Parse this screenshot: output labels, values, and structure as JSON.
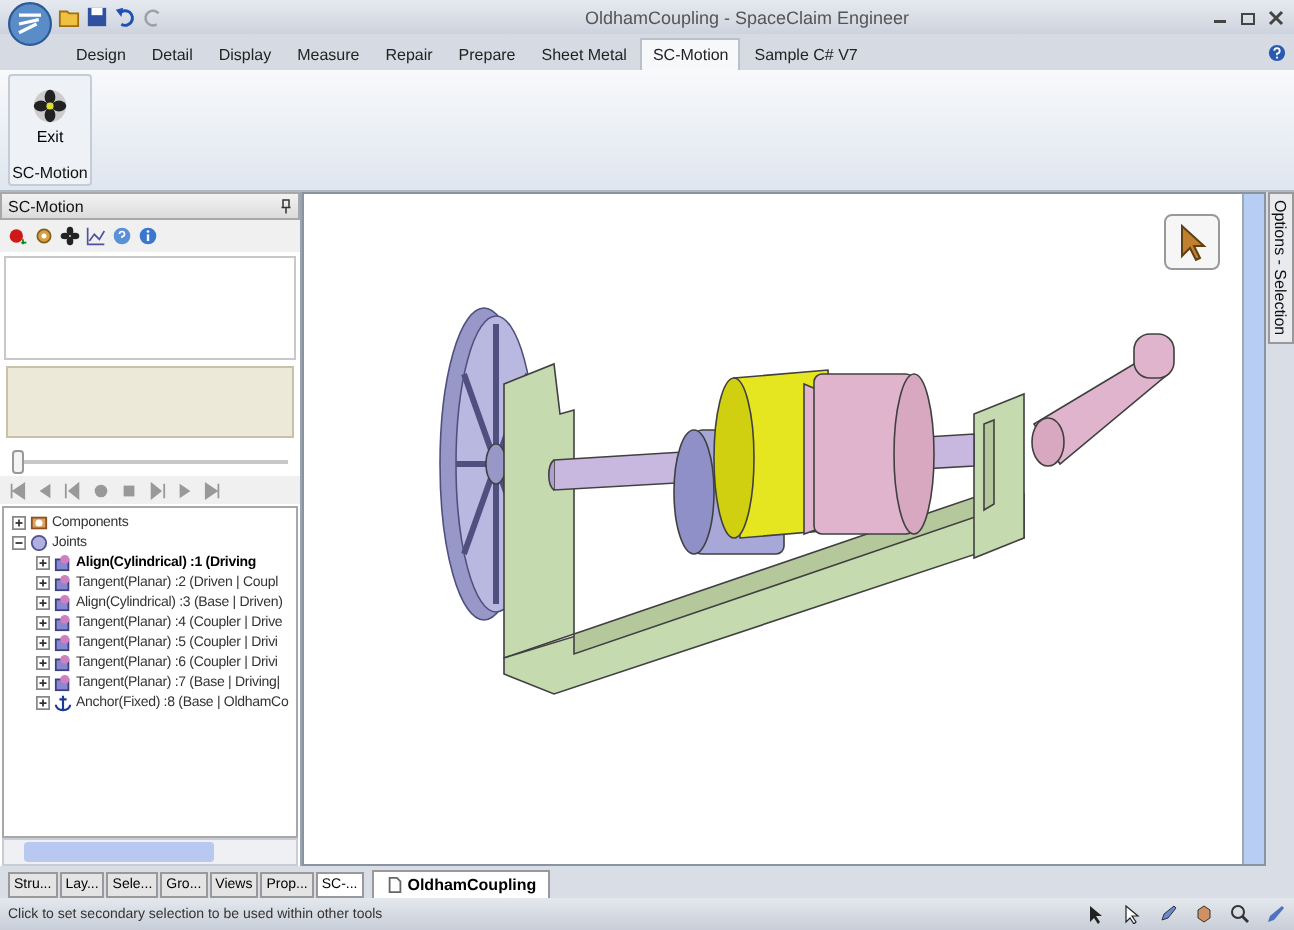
{
  "window": {
    "title": "OldhamCoupling - SpaceClaim Engineer"
  },
  "ribbon_tabs": [
    {
      "label": "Design",
      "selected": false
    },
    {
      "label": "Detail",
      "selected": false
    },
    {
      "label": "Display",
      "selected": false
    },
    {
      "label": "Measure",
      "selected": false
    },
    {
      "label": "Repair",
      "selected": false
    },
    {
      "label": "Prepare",
      "selected": false
    },
    {
      "label": "Sheet Metal",
      "selected": false
    },
    {
      "label": "SC-Motion",
      "selected": true
    },
    {
      "label": "Sample C# V7",
      "selected": false
    }
  ],
  "ribbon": {
    "button": "Exit",
    "group": "SC-Motion"
  },
  "panel": {
    "title": "SC-Motion",
    "slider": {
      "level": 0.0
    },
    "tree": [
      {
        "label": "Components",
        "kind": "components",
        "expanded": false,
        "selected": false
      },
      {
        "label": "Joints",
        "kind": "joints",
        "expanded": true,
        "selected": false,
        "children": [
          {
            "label": "Align(Cylindrical) :1 (Driving",
            "kind": "joint",
            "selected": true
          },
          {
            "label": "Tangent(Planar) :2 (Driven | Coupl",
            "kind": "joint",
            "selected": false
          },
          {
            "label": "Align(Cylindrical) :3 (Base | Driven)",
            "kind": "joint",
            "selected": false
          },
          {
            "label": "Tangent(Planar) :4 (Coupler | Drive",
            "kind": "joint",
            "selected": false
          },
          {
            "label": "Tangent(Planar) :5 (Coupler | Drivi",
            "kind": "joint",
            "selected": false
          },
          {
            "label": "Tangent(Planar) :6 (Coupler | Drivi",
            "kind": "joint",
            "selected": false
          },
          {
            "label": "Tangent(Planar) :7 (Base | Driving|",
            "kind": "joint",
            "selected": false
          },
          {
            "label": "Anchor(Fixed) :8 (Base | OldhamCo",
            "kind": "anchor",
            "selected": false
          }
        ]
      }
    ]
  },
  "side_tab": "Options - Selection",
  "bottom_tabs": [
    {
      "label": "Stru...",
      "selected": false
    },
    {
      "label": "Lay...",
      "selected": false
    },
    {
      "label": "Sele...",
      "selected": false
    },
    {
      "label": "Gro...",
      "selected": false
    },
    {
      "label": "Views",
      "selected": false
    },
    {
      "label": "Prop...",
      "selected": false
    },
    {
      "label": "SC-...",
      "selected": true
    }
  ],
  "document_tab": "OldhamCoupling",
  "status_bar": {
    "text": "Click to set secondary selection to be used within other tools"
  }
}
